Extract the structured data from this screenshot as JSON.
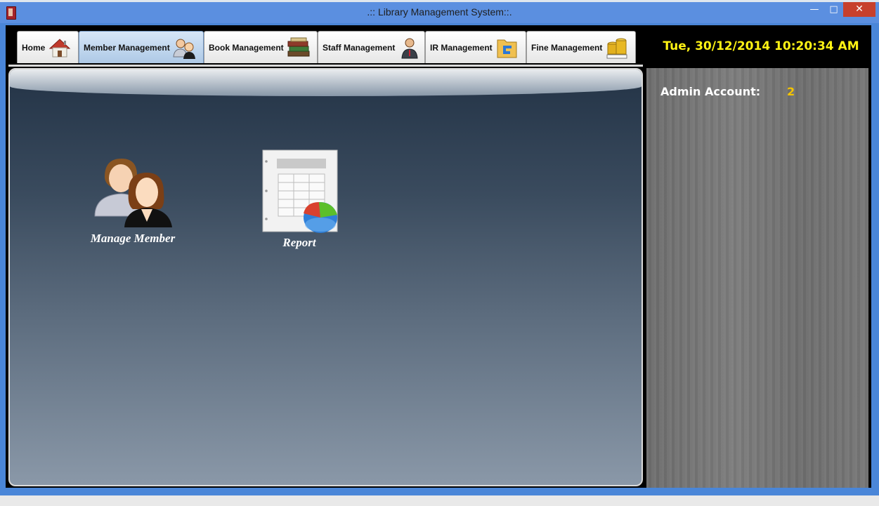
{
  "window": {
    "title": ".:: Library Management System::.",
    "minimize_glyph": "—",
    "maximize_glyph": "□",
    "close_glyph": "✕"
  },
  "tabs": [
    {
      "label": "Home",
      "icon": "house-icon",
      "active": false
    },
    {
      "label": "Member Management",
      "icon": "members-icon",
      "active": true
    },
    {
      "label": "Book Management",
      "icon": "books-icon",
      "active": false
    },
    {
      "label": "Staff Management",
      "icon": "staff-icon",
      "active": false
    },
    {
      "label": "IR Management",
      "icon": "folder-icon",
      "active": false
    },
    {
      "label": "Fine Management",
      "icon": "money-icon",
      "active": false
    }
  ],
  "clock": "Tue, 30/12/2014 10:20:34 AM",
  "main": {
    "actions": [
      {
        "label": "Manage Member",
        "icon": "manage-member-icon"
      },
      {
        "label": "Report",
        "icon": "report-icon"
      }
    ]
  },
  "side": {
    "admin_label": "Admin Account:",
    "admin_count": "2"
  },
  "colors": {
    "titlebar": "#5b8fe0",
    "clock_text": "#fff314",
    "admin_count": "#f4c400",
    "close_button": "#c7402c"
  }
}
